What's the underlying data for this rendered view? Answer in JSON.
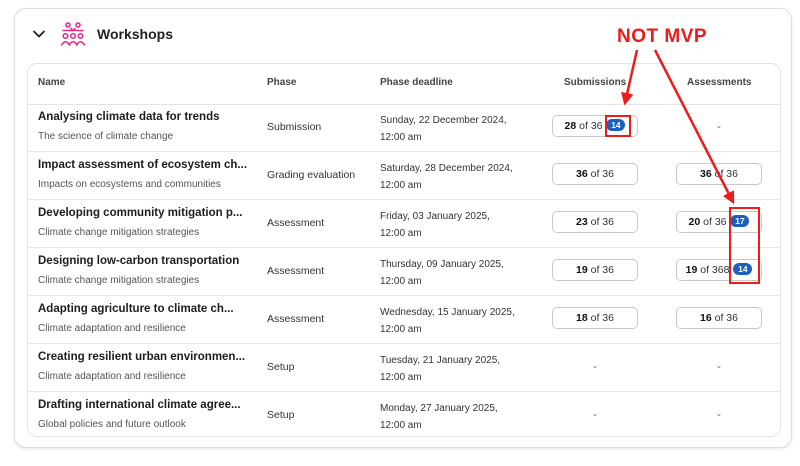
{
  "header": {
    "title": "Workshops"
  },
  "table": {
    "columns": [
      "Name",
      "Phase",
      "Phase deadline",
      "Submissions",
      "Assessments"
    ],
    "rows": [
      {
        "name": "Analysing climate data for trends",
        "subtitle": "The science of climate change",
        "phase": "Submission",
        "deadline_line1": "Sunday, 22 December 2024,",
        "deadline_line2": "12:00 am",
        "submissions": {
          "count": "28",
          "of": "of 36",
          "badge": "14"
        },
        "assessments": {
          "empty": "-"
        }
      },
      {
        "name": "Impact assessment of ecosystem ch...",
        "subtitle": "Impacts on ecosystems and communities",
        "phase": "Grading evaluation",
        "deadline_line1": "Saturday, 28 December 2024,",
        "deadline_line2": "12:00 am",
        "submissions": {
          "count": "36",
          "of": "of 36"
        },
        "assessments": {
          "count": "36",
          "of": "of 36"
        }
      },
      {
        "name": "Developing community mitigation p...",
        "subtitle": "Climate change mitigation strategies",
        "phase": "Assessment",
        "deadline_line1": "Friday, 03 January 2025,",
        "deadline_line2": "12:00 am",
        "submissions": {
          "count": "23",
          "of": "of 36"
        },
        "assessments": {
          "count": "20",
          "of": "of 36",
          "badge": "17"
        }
      },
      {
        "name": "Designing low-carbon transportation",
        "subtitle": "Climate change mitigation strategies",
        "phase": "Assessment",
        "deadline_line1": "Thursday, 09 January 2025,",
        "deadline_line2": "12:00 am",
        "submissions": {
          "count": "19",
          "of": "of 36"
        },
        "assessments": {
          "count": "19",
          "of": "of 368",
          "badge": "14"
        }
      },
      {
        "name": "Adapting agriculture to climate ch...",
        "subtitle": "Climate adaptation and resilience",
        "phase": "Assessment",
        "deadline_line1": "Wednesday, 15 January 2025,",
        "deadline_line2": "12:00 am",
        "submissions": {
          "count": "18",
          "of": "of 36"
        },
        "assessments": {
          "count": "16",
          "of": "of 36"
        }
      },
      {
        "name": "Creating resilient urban environmen...",
        "subtitle": "Climate adaptation and resilience",
        "phase": "Setup",
        "deadline_line1": "Tuesday, 21 January 2025,",
        "deadline_line2": "12:00 am",
        "submissions": {
          "empty": "-"
        },
        "assessments": {
          "empty": "-"
        }
      },
      {
        "name": "Drafting international climate agree...",
        "subtitle": "Global policies and future outlook",
        "phase": "Setup",
        "deadline_line1": "Monday, 27 January 2025,",
        "deadline_line2": "12:00 am",
        "submissions": {
          "empty": "-"
        },
        "assessments": {
          "empty": "-"
        }
      }
    ]
  },
  "annotation": {
    "label": "NOT MVP",
    "color": "#ee1b1b"
  },
  "colors": {
    "brand_icon": "#e8268a",
    "badge": "#1b5fbf"
  },
  "icons": {
    "collapse": "chevron-down-icon",
    "workshop": "workshop-people-icon"
  }
}
